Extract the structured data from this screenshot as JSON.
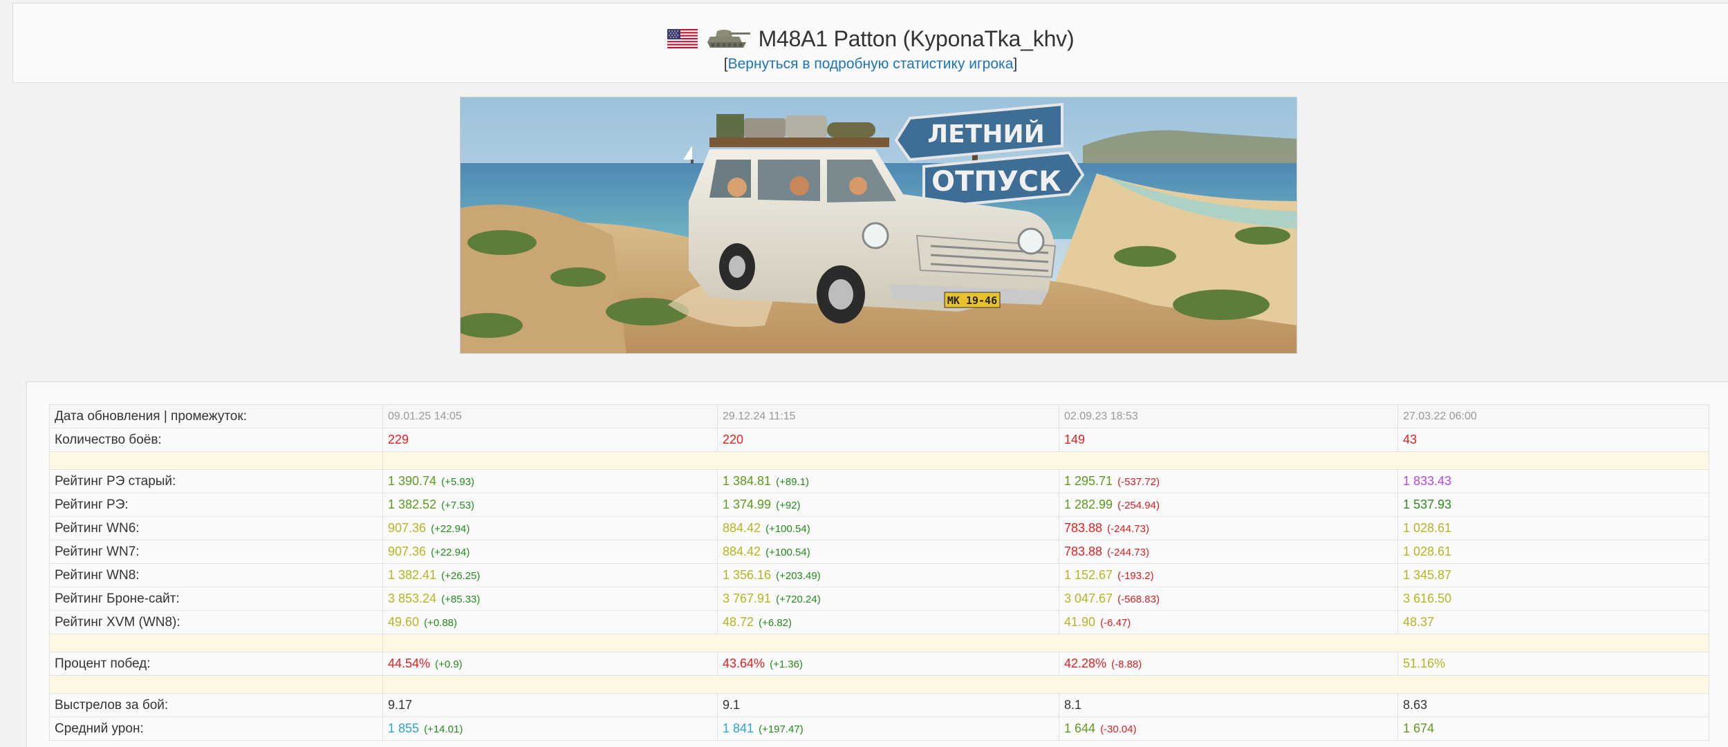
{
  "header": {
    "title": "M48A1 Patton (KyponaTka_khv)",
    "flag_icon": "usa-flag-icon",
    "tank_icon": "tank-icon",
    "back_prefix": "[",
    "back_link": "Вернуться в подробную статистику игрока",
    "back_suffix": "]"
  },
  "banner": {
    "sign_line1": "ЛЕТНИЙ",
    "sign_line2": "ОТПУСК",
    "plate": "МК 19-46"
  },
  "stats": {
    "date_row": {
      "label": "Дата обновления | промежуток:",
      "values": [
        "09.01.25 14:05",
        "29.12.24 11:15",
        "02.09.23 18:53",
        "27.03.22 06:00"
      ]
    },
    "rows": [
      {
        "label": "Количество боёв:",
        "cells": [
          {
            "v": "229",
            "c": "red",
            "d": ""
          },
          {
            "v": "220",
            "c": "red",
            "d": ""
          },
          {
            "v": "149",
            "c": "red",
            "d": ""
          },
          {
            "v": "43",
            "c": "red",
            "d": ""
          }
        ]
      },
      {
        "sep": true
      },
      {
        "label": "Рейтинг РЭ старый:",
        "cells": [
          {
            "v": "1 390.74",
            "c": "green",
            "d": "(+5.93)",
            "dc": "green"
          },
          {
            "v": "1 384.81",
            "c": "green",
            "d": "(+89.1)",
            "dc": "green"
          },
          {
            "v": "1 295.71",
            "c": "green",
            "d": "(-537.72)",
            "dc": "red"
          },
          {
            "v": "1 833.43",
            "c": "purple",
            "d": ""
          }
        ]
      },
      {
        "label": "Рейтинг РЭ:",
        "cells": [
          {
            "v": "1 382.52",
            "c": "green",
            "d": "(+7.53)",
            "dc": "green"
          },
          {
            "v": "1 374.99",
            "c": "green",
            "d": "(+92)",
            "dc": "green"
          },
          {
            "v": "1 282.99",
            "c": "green",
            "d": "(-254.94)",
            "dc": "red"
          },
          {
            "v": "1 537.93",
            "c": "dgreen",
            "d": ""
          }
        ]
      },
      {
        "label": "Рейтинг WN6:",
        "cells": [
          {
            "v": "907.36",
            "c": "yellow",
            "d": "(+22.94)",
            "dc": "green"
          },
          {
            "v": "884.42",
            "c": "yellow",
            "d": "(+100.54)",
            "dc": "green"
          },
          {
            "v": "783.88",
            "c": "red",
            "d": "(-244.73)",
            "dc": "red"
          },
          {
            "v": "1 028.61",
            "c": "yellow",
            "d": ""
          }
        ]
      },
      {
        "label": "Рейтинг WN7:",
        "cells": [
          {
            "v": "907.36",
            "c": "yellow",
            "d": "(+22.94)",
            "dc": "green"
          },
          {
            "v": "884.42",
            "c": "yellow",
            "d": "(+100.54)",
            "dc": "green"
          },
          {
            "v": "783.88",
            "c": "red",
            "d": "(-244.73)",
            "dc": "red"
          },
          {
            "v": "1 028.61",
            "c": "yellow",
            "d": ""
          }
        ]
      },
      {
        "label": "Рейтинг WN8:",
        "cells": [
          {
            "v": "1 382.41",
            "c": "yellow",
            "d": "(+26.25)",
            "dc": "green"
          },
          {
            "v": "1 356.16",
            "c": "yellow",
            "d": "(+203.49)",
            "dc": "green"
          },
          {
            "v": "1 152.67",
            "c": "yellow",
            "d": "(-193.2)",
            "dc": "red"
          },
          {
            "v": "1 345.87",
            "c": "yellow",
            "d": ""
          }
        ]
      },
      {
        "label": "Рейтинг Броне-сайт:",
        "cells": [
          {
            "v": "3 853.24",
            "c": "yellow",
            "d": "(+85.33)",
            "dc": "green"
          },
          {
            "v": "3 767.91",
            "c": "yellow",
            "d": "(+720.24)",
            "dc": "green"
          },
          {
            "v": "3 047.67",
            "c": "yellow",
            "d": "(-568.83)",
            "dc": "red"
          },
          {
            "v": "3 616.50",
            "c": "yellow",
            "d": ""
          }
        ]
      },
      {
        "label": "Рейтинг XVM (WN8):",
        "cells": [
          {
            "v": "49.60",
            "c": "yellow",
            "d": "(+0.88)",
            "dc": "green"
          },
          {
            "v": "48.72",
            "c": "yellow",
            "d": "(+6.82)",
            "dc": "green"
          },
          {
            "v": "41.90",
            "c": "yellow",
            "d": "(-6.47)",
            "dc": "red"
          },
          {
            "v": "48.37",
            "c": "yellow",
            "d": ""
          }
        ]
      },
      {
        "sep": true
      },
      {
        "label": "Процент побед:",
        "cells": [
          {
            "v": "44.54%",
            "c": "red",
            "d": "(+0.9)",
            "dc": "green"
          },
          {
            "v": "43.64%",
            "c": "red",
            "d": "(+1.36)",
            "dc": "green"
          },
          {
            "v": "42.28%",
            "c": "red",
            "d": "(-8.88)",
            "dc": "red"
          },
          {
            "v": "51.16%",
            "c": "yellow",
            "d": ""
          }
        ]
      },
      {
        "sep": true
      },
      {
        "label": "Выстрелов за бой:",
        "cells": [
          {
            "v": "9.17",
            "c": "dark",
            "d": ""
          },
          {
            "v": "9.1",
            "c": "dark",
            "d": ""
          },
          {
            "v": "8.1",
            "c": "dark",
            "d": ""
          },
          {
            "v": "8.63",
            "c": "dark",
            "d": ""
          }
        ]
      },
      {
        "label": "Средний урон:",
        "cells": [
          {
            "v": "1 855",
            "c": "cyan",
            "d": "(+14.01)",
            "dc": "green"
          },
          {
            "v": "1 841",
            "c": "cyan",
            "d": "(+197.47)",
            "dc": "green"
          },
          {
            "v": "1 644",
            "c": "green",
            "d": "(-30.04)",
            "dc": "red"
          },
          {
            "v": "1 674",
            "c": "green",
            "d": ""
          }
        ]
      }
    ]
  },
  "colors": {
    "red": "#e52020",
    "green": "#5b9b1a",
    "dgreen": "#2e8b1e",
    "yellow": "#b5b521",
    "purple": "#b347e8",
    "cyan": "#29a3d9",
    "dark": "#333333",
    "link": "#1e73be",
    "separator_bg": "#fdf8e4"
  }
}
